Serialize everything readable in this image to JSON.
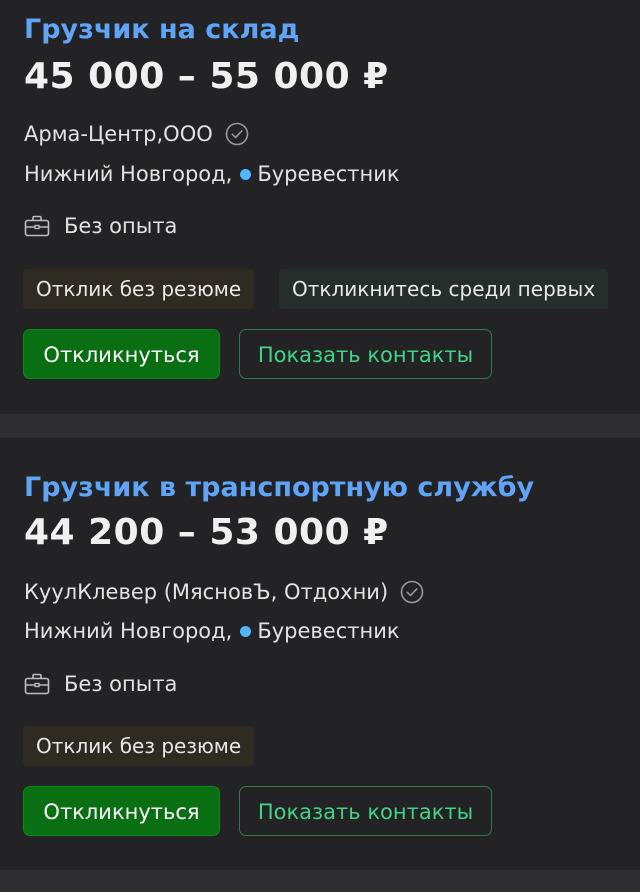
{
  "vacancies": [
    {
      "title": "Грузчик на склад",
      "salary": "45 000 – 55 000 ₽",
      "company": "Арма-Центр,ООО",
      "company_verified": true,
      "city": "Нижний Новгород,",
      "metro": "Буревестник",
      "metro_color": "#4fb7ff",
      "experience": "Без опыта",
      "tags": [
        "Отклик без резюме",
        "Откликнитесь среди первых"
      ],
      "apply_label": "Откликнуться",
      "contacts_label": "Показать контакты"
    },
    {
      "title": "Грузчик в транспортную службу",
      "salary": "44 200 – 53 000 ₽",
      "company": "КуулКлевер (МясновЪ, Отдохни)",
      "company_verified": true,
      "city": "Нижний Новгород,",
      "metro": "Буревестник",
      "metro_color": "#4fb7ff",
      "experience": "Без опыта",
      "tags": [
        "Отклик без резюме"
      ],
      "apply_label": "Откликнуться",
      "contacts_label": "Показать контакты"
    }
  ],
  "icons": {
    "verified": "check-circle-icon",
    "experience": "briefcase-icon"
  },
  "colors": {
    "title": "#5fa4f6",
    "primary_button": "#0a6e12",
    "secondary_button_text": "#3fd486",
    "background": "#1b1b1d",
    "card": "#232325"
  }
}
